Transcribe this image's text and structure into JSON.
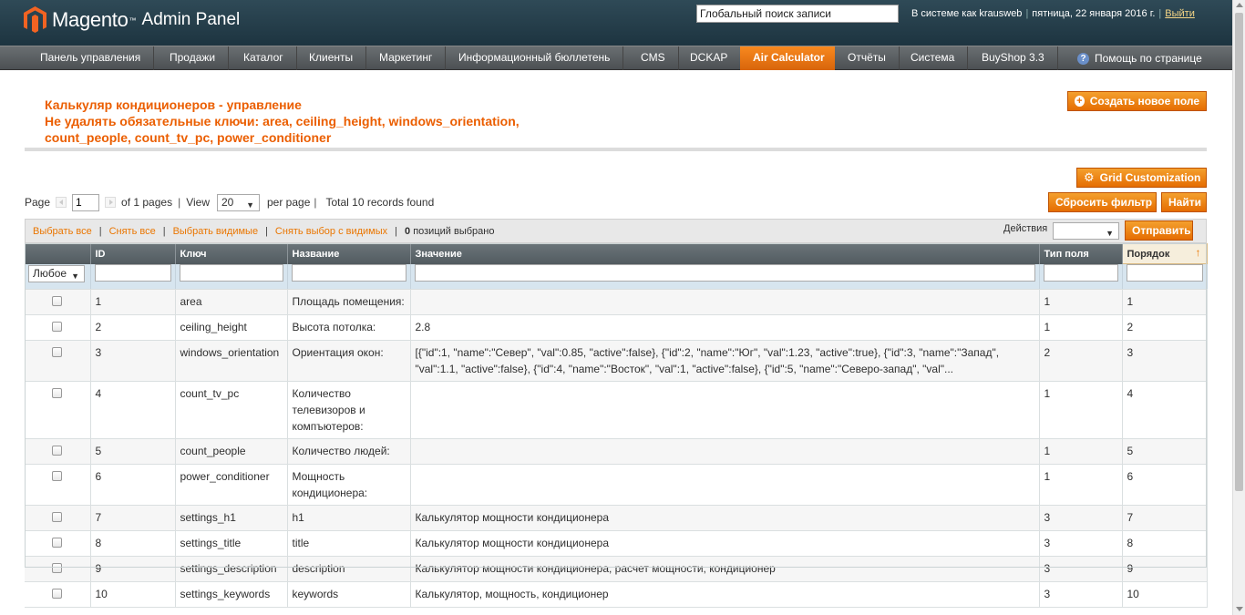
{
  "header": {
    "brand": "Magento",
    "admin_label": "Admin Panel",
    "search_value": "Глобальный поиск записи",
    "logged_in_text": "В системе как krausweb",
    "date_text": "пятница, 22 января 2016 г.",
    "logout_label": "Выйти"
  },
  "nav": {
    "items": [
      {
        "label": "Панель управления"
      },
      {
        "label": "Продажи"
      },
      {
        "label": "Каталог"
      },
      {
        "label": "Клиенты"
      },
      {
        "label": "Маркетинг"
      },
      {
        "label": "Информационный бюллетень"
      },
      {
        "label": "CMS"
      },
      {
        "label": "DCKAP"
      },
      {
        "label": "Air Calculator"
      },
      {
        "label": "Отчёты"
      },
      {
        "label": "Система"
      },
      {
        "label": "BuyShop 3.3"
      }
    ],
    "active_item": "Air Calculator",
    "help_label": "Помощь по странице"
  },
  "page": {
    "title_line1": "Калькуляр кондиционеров - управление",
    "title_line2": "Не удалять обязательные ключи: area, ceiling_height, windows_orientation,",
    "title_line3": "count_people, count_tv_pc, power_conditioner",
    "create_button": "Создать новое поле",
    "grid_customization_button": "Grid Customization",
    "reset_filter_button": "Сбросить фильтр",
    "search_button": "Найти"
  },
  "pager": {
    "page_label": "Page",
    "page_value": "1",
    "of_pages": "of 1 pages",
    "view_label": "View",
    "view_value": "20",
    "per_page": "per page",
    "total": "Total 10 records found"
  },
  "massaction": {
    "select_all": "Выбрать все",
    "unselect_all": "Снять все",
    "select_visible": "Выбрать видимые",
    "unselect_visible": "Снять выбор с видимых",
    "selected_count": "0",
    "selected_label": "позиций выбрано",
    "actions_label": "Действия",
    "submit_button": "Отправить"
  },
  "grid": {
    "columns": [
      "",
      "ID",
      "Ключ",
      "Название",
      "Значение",
      "Тип поля",
      "Порядок"
    ],
    "filter_any": "Любое",
    "rows": [
      {
        "id": "1",
        "key": "area",
        "name": "Площадь помещения:",
        "value": "",
        "type": "1",
        "order": "1"
      },
      {
        "id": "2",
        "key": "ceiling_height",
        "name": "Высота потолка:",
        "value": "2.8",
        "type": "1",
        "order": "2"
      },
      {
        "id": "3",
        "key": "windows_orientation",
        "name": "Ориентация окон:",
        "value": "[{\"id\":1, \"name\":\"Север\", \"val\":0.85, \"active\":false}, {\"id\":2, \"name\":\"Юг\", \"val\":1.23, \"active\":true}, {\"id\":3, \"name\":\"Запад\", \"val\":1.1, \"active\":false}, {\"id\":4, \"name\":\"Восток\", \"val\":1, \"active\":false}, {\"id\":5, \"name\":\"Северо-запад\", \"val\"...",
        "type": "2",
        "order": "3"
      },
      {
        "id": "4",
        "key": "count_tv_pc",
        "name": "Количество телевизоров и компъютеров:",
        "value": "",
        "type": "1",
        "order": "4"
      },
      {
        "id": "5",
        "key": "count_people",
        "name": "Количество людей:",
        "value": "",
        "type": "1",
        "order": "5"
      },
      {
        "id": "6",
        "key": "power_conditioner",
        "name": "Мощность кондиционера:",
        "value": "",
        "type": "1",
        "order": "6"
      },
      {
        "id": "7",
        "key": "settings_h1",
        "name": "h1",
        "value": "Калькулятор мощности кондиционера",
        "type": "3",
        "order": "7"
      },
      {
        "id": "8",
        "key": "settings_title",
        "name": "title",
        "value": "Калькулятор мощности кондиционера",
        "type": "3",
        "order": "8"
      },
      {
        "id": "9",
        "key": "settings_description",
        "name": "description",
        "value": "Калькулятор мощности кондиционера, расчет мощности, кондиционер",
        "type": "3",
        "order": "9"
      },
      {
        "id": "10",
        "key": "settings_keywords",
        "name": "keywords",
        "value": "Калькулятор, мощность, кондиционер",
        "type": "3",
        "order": "10"
      }
    ]
  },
  "colors": {
    "accent": "#ea7601",
    "title": "#eb5e00",
    "header_bg": "#1d3440"
  }
}
